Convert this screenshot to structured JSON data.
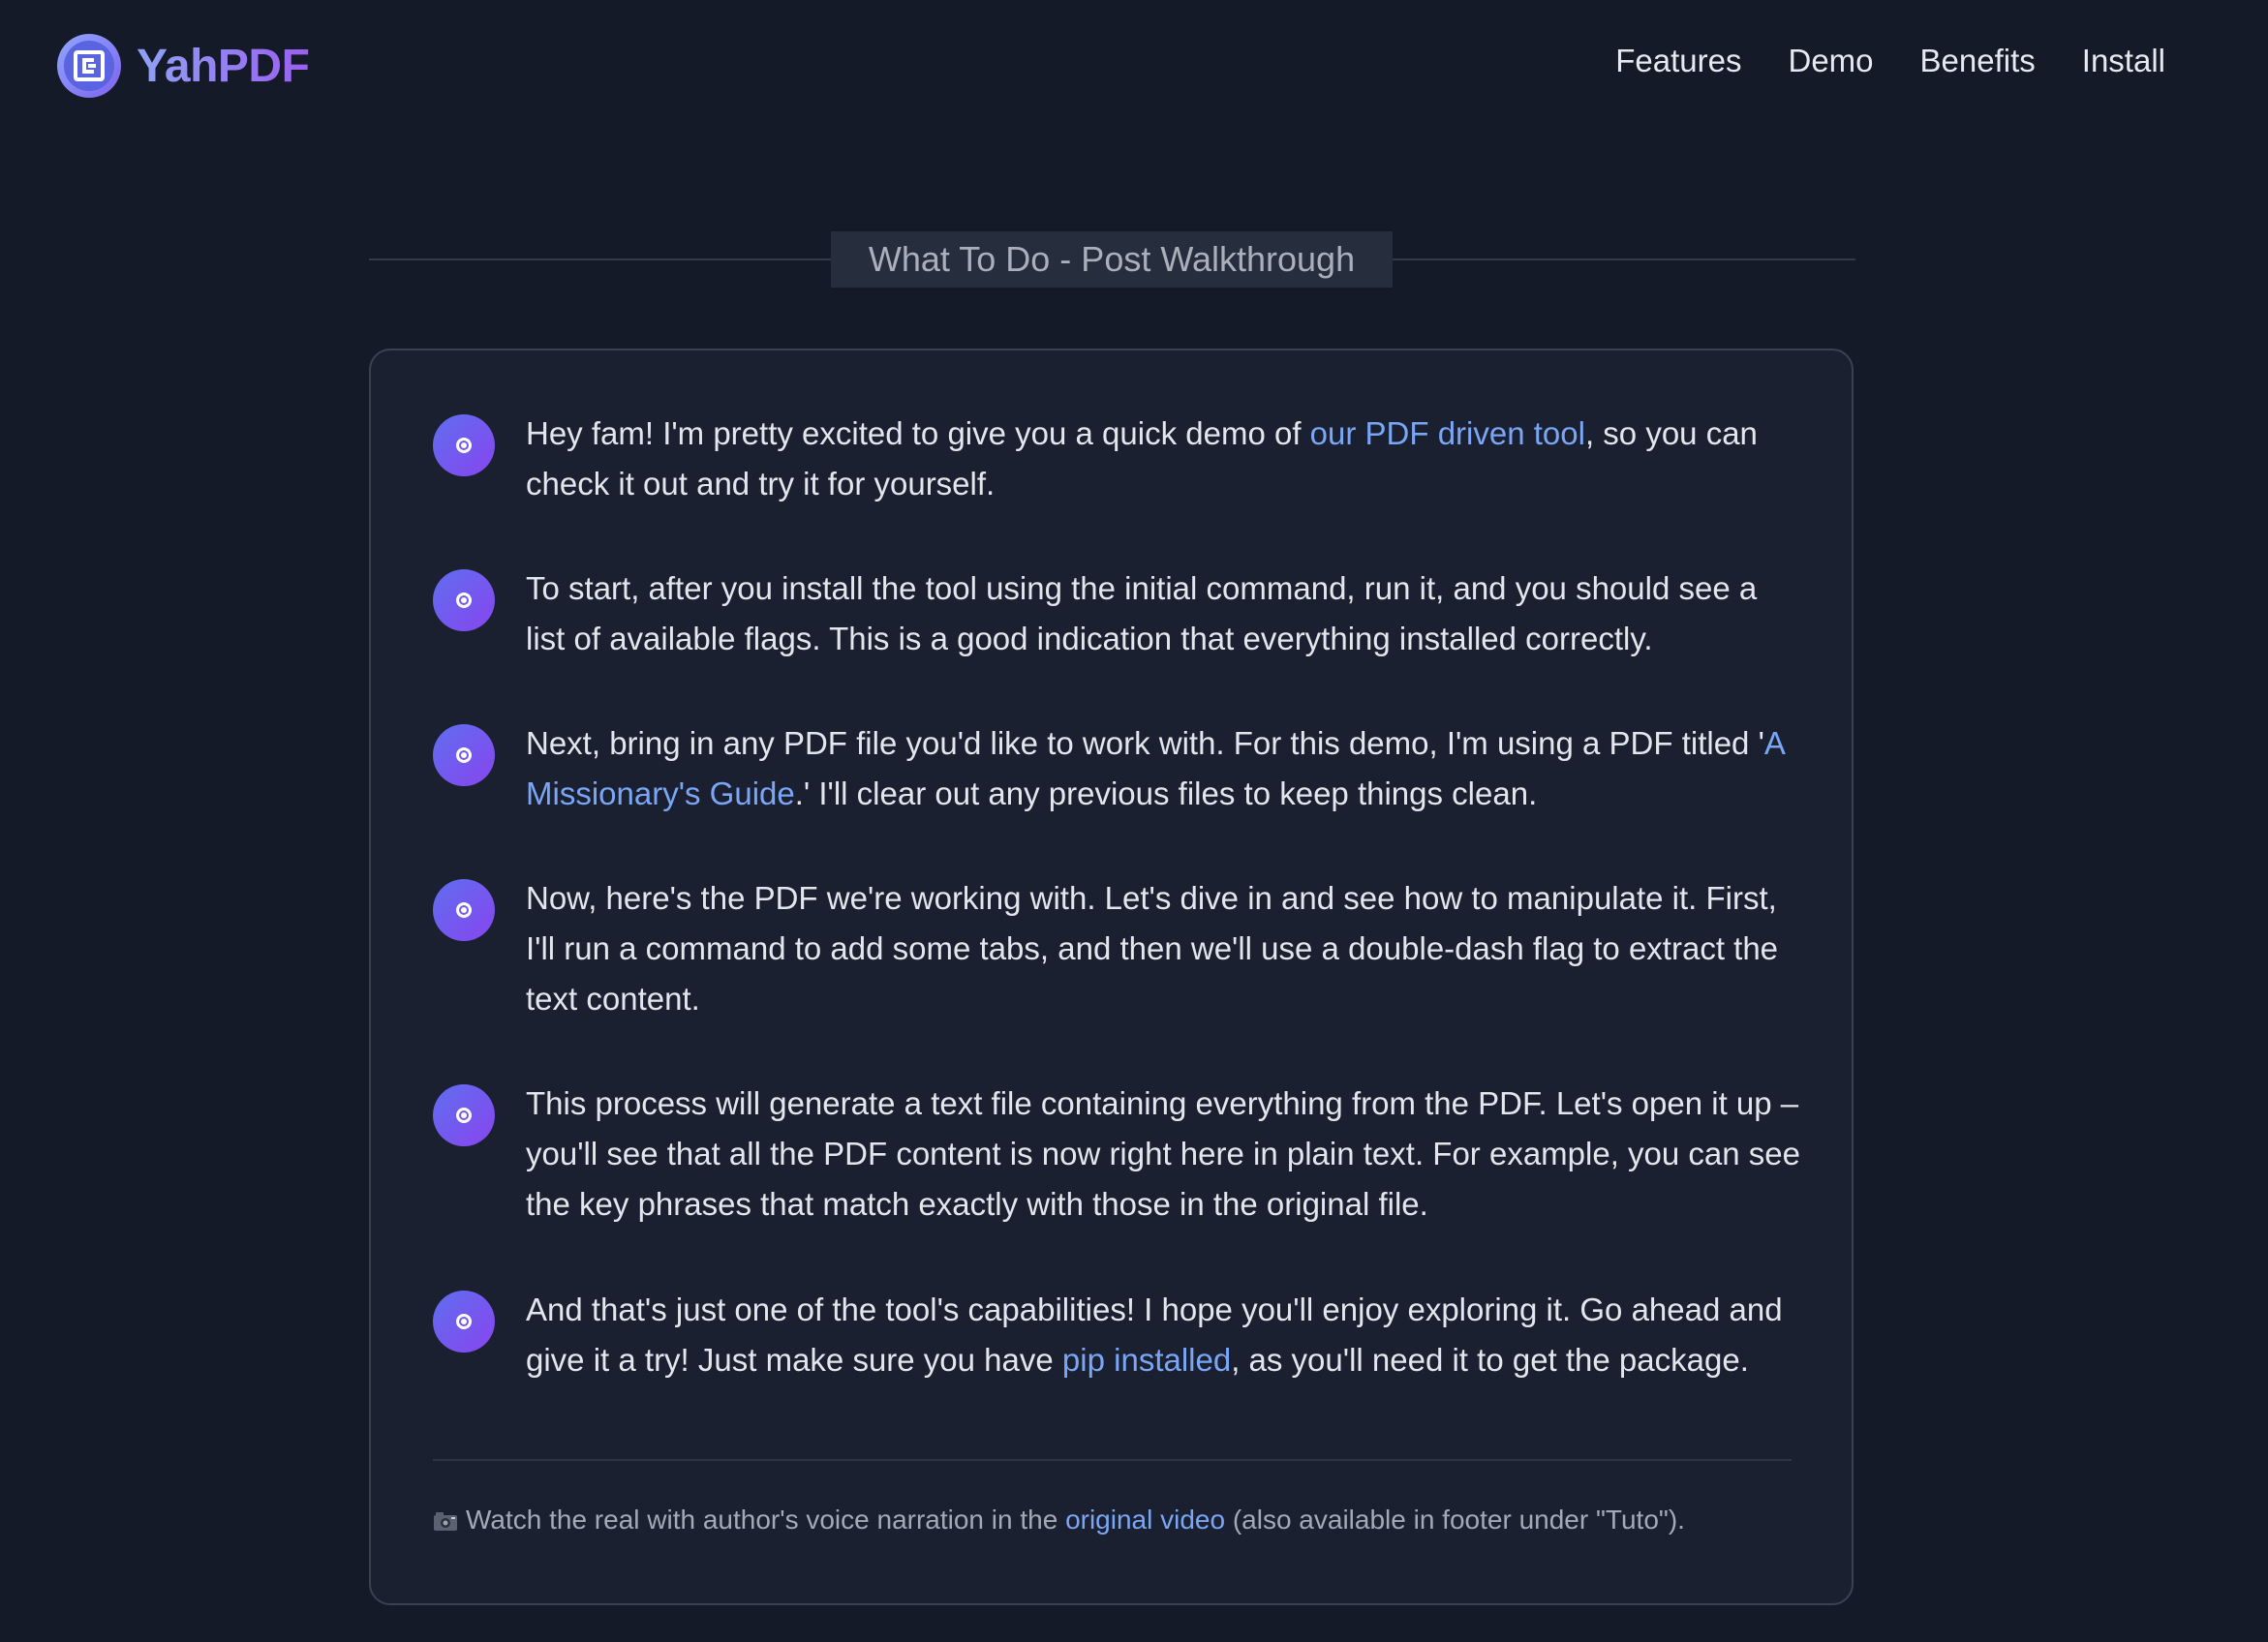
{
  "header": {
    "brand_name": "YahPDF",
    "nav": [
      {
        "label": "Features"
      },
      {
        "label": "Demo"
      },
      {
        "label": "Benefits"
      },
      {
        "label": "Install"
      }
    ]
  },
  "section": {
    "title": "What To Do - Post Walkthrough"
  },
  "steps": [
    {
      "parts": [
        "Hey fam! I'm pretty excited to give you a quick demo of ",
        "our PDF driven tool",
        ", so you can check it out and try it for yourself."
      ]
    },
    {
      "text": "To start, after you install the tool using the initial command, run it, and you should see a list of available flags. This is a good indication that everything installed correctly."
    },
    {
      "parts": [
        "Next, bring in any PDF file you'd like to work with. For this demo, I'm using a PDF titled '",
        "A Missionary's Guide",
        ".' I'll clear out any previous files to keep things clean."
      ]
    },
    {
      "text": "Now, here's the PDF we're working with. Let's dive in and see how to manipulate it. First, I'll run a command to add some tabs, and then we'll use a double-dash flag to extract the text content."
    },
    {
      "text": "This process will generate a text file containing everything from the PDF. Let's open it up – you'll see that all the PDF content is now right here in plain text. For example, you can see the key phrases that match exactly with those in the original file."
    },
    {
      "parts": [
        "And that's just one of the tool's capabilities! I hope you'll enjoy exploring it. Go ahead and give it a try! Just make sure you have ",
        "pip installed",
        ", as you'll need it to get the package."
      ]
    }
  ],
  "footnote": {
    "icon": "video-camera-icon",
    "before": "Watch the real with author's voice narration in the ",
    "link": "original video",
    "after": " (also available in footer under \"Tuto\")."
  },
  "colors": {
    "background": "#141a28",
    "card": "#1a2030",
    "link": "#7aa6f5",
    "accent_start": "#5f6ef0",
    "accent_end": "#8845ee"
  }
}
